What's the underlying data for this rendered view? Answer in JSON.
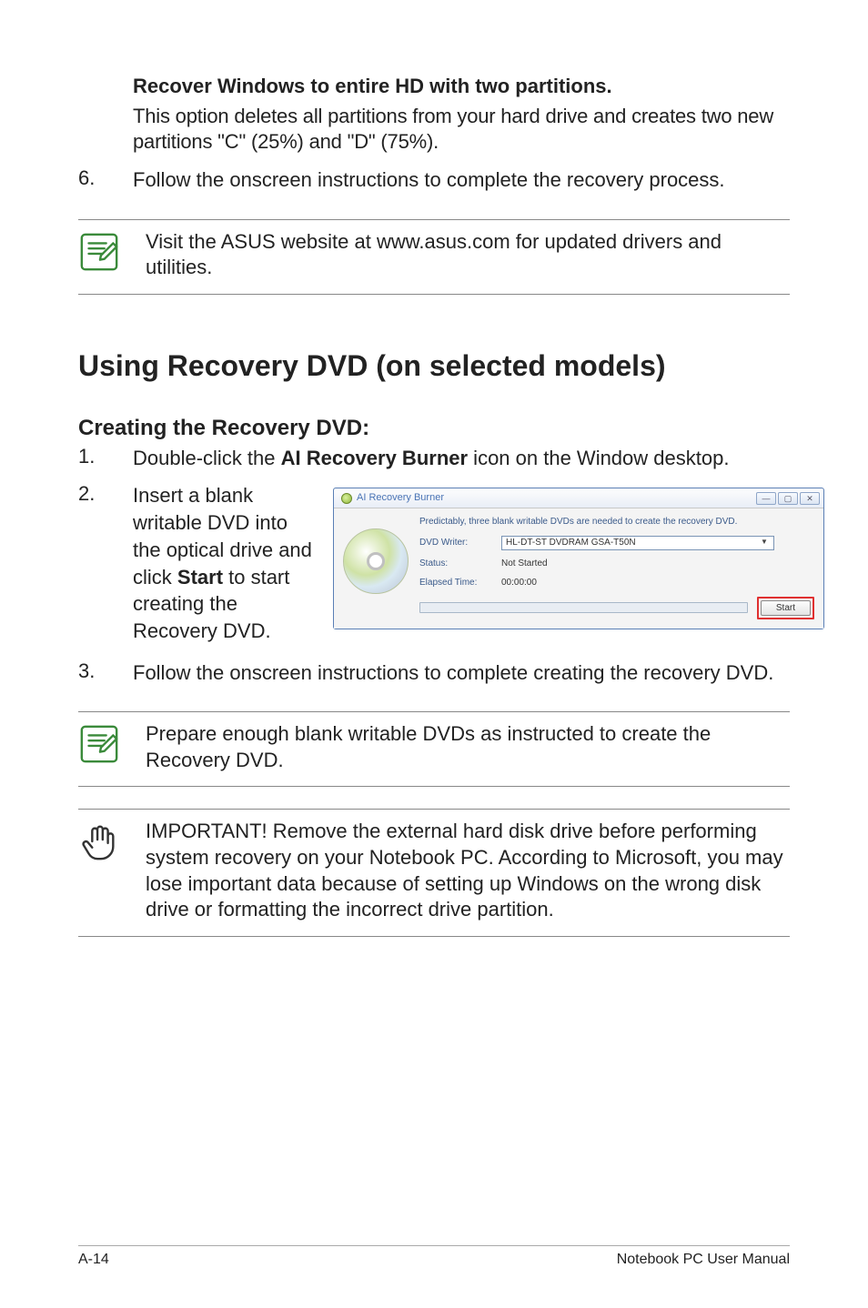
{
  "section_recover": {
    "title": "Recover Windows to entire HD with two partitions.",
    "body": "This option deletes all partitions from your hard drive and creates two new partitions \"C\" (25%) and \"D\" (75%)."
  },
  "step6": {
    "num": "6.",
    "text": "Follow the onscreen instructions to complete the recovery process."
  },
  "note_asus": "Visit the ASUS website at www.asus.com for updated drivers and utilities.",
  "h1": "Using Recovery DVD (on selected models)",
  "h2": "Creating the Recovery DVD:",
  "step1": {
    "num": "1.",
    "pre": "Double-click the ",
    "bold": "AI Recovery Burner",
    "post": " icon on the Window desktop."
  },
  "step2": {
    "num": "2.",
    "pre": "Insert a blank writable DVD into the optical drive and click ",
    "bold": "Start",
    "post": " to start creating the Recovery DVD."
  },
  "burner": {
    "title": "AI Recovery Burner",
    "message": "Predictably, three blank writable DVDs are needed to create the recovery DVD.",
    "labels": {
      "writer": "DVD Writer:",
      "status": "Status:",
      "elapsed": "Elapsed Time:"
    },
    "values": {
      "writer": "HL-DT-ST DVDRAM GSA-T50N",
      "status": "Not Started",
      "elapsed": "00:00:00"
    },
    "start_btn": "Start"
  },
  "step3": {
    "num": "3.",
    "text": "Follow the onscreen instructions to complete creating the recovery DVD."
  },
  "note_blank": "Prepare enough blank writable DVDs as instructed to create the Recovery DVD.",
  "note_important": "IMPORTANT! Remove the external hard disk drive before performing system recovery on your Notebook PC. According to Microsoft, you may lose important data because of setting up Windows on the wrong disk drive or formatting the incorrect drive partition.",
  "footer": {
    "left": "A-14",
    "right": "Notebook PC User Manual"
  }
}
